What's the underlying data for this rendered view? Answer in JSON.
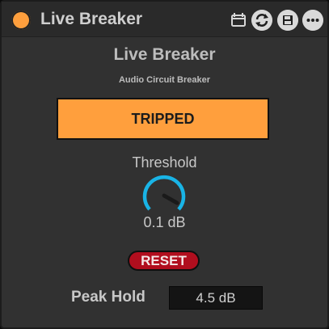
{
  "device": {
    "title": "Live Breaker",
    "power_color": "#ff9f3d",
    "header_icons": [
      "clip-icon",
      "hot-swap-icon",
      "save-icon",
      "more-icon"
    ]
  },
  "panel": {
    "name": "Live Breaker",
    "subtitle": "Audio Circuit Breaker",
    "status": "TRIPPED",
    "status_color": "#ff9f3d",
    "threshold": {
      "label": "Threshold",
      "value": "0.1 dB",
      "accent": "#19b4e6"
    },
    "reset_label": "RESET",
    "reset_color": "#b10e1e",
    "peak": {
      "label": "Peak Hold",
      "value": "4.5 dB"
    }
  }
}
